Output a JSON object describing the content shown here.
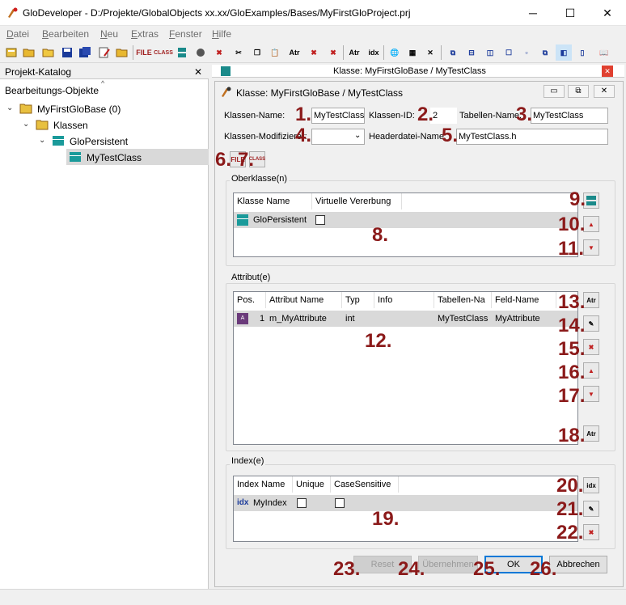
{
  "window": {
    "title": "GloDeveloper - D:/Projekte/GlobalObjects xx.xx/GloExamples/Bases/MyFirstGloProject.prj",
    "minimize": "─",
    "maximize": "☐",
    "close": "✕"
  },
  "menu": [
    {
      "key": "D",
      "rest": "atei"
    },
    {
      "key": "B",
      "rest": "earbeiten"
    },
    {
      "key": "N",
      "rest": "eu"
    },
    {
      "key": "E",
      "rest": "xtras"
    },
    {
      "key": "F",
      "rest": "enster"
    },
    {
      "key": "H",
      "rest": "ilfe"
    }
  ],
  "toolbar": {
    "file_label": "FILE",
    "class_label": "CLASS",
    "attr_label": "Atr",
    "idx_label": "idx"
  },
  "catalog": {
    "title": "Projekt-Katalog",
    "close": "✕",
    "root_label": "Bearbeitungs-Objekte",
    "base": "MyFirstGloBase (0)",
    "classes": "Klassen",
    "persistent": "GloPersistent",
    "selected": "MyTestClass"
  },
  "doc_tab": {
    "title": "Klasse: MyFirstGloBase / MyTestClass",
    "close": "✕"
  },
  "dialog": {
    "title": "Klasse: MyFirstGloBase / MyTestClass",
    "btn_min": "▭",
    "btn_restore": "⧉",
    "btn_close": "✕",
    "class_name_label": "Klassen-Name:",
    "class_name_value": "MyTestClass",
    "class_id_label": "Klassen-ID:",
    "class_id_value": "2",
    "table_name_label": "Tabellen-Name:",
    "table_name_value": "MyTestClass",
    "modifier_label": "Klassen-Modifizierer:",
    "modifier_value": "",
    "header_label": "Headerdatei-Name:",
    "header_value": "MyTestClass.h",
    "superclass_group": "Oberklasse(n)",
    "superclass_cols": [
      "Klasse Name",
      "Virtuelle Vererbung"
    ],
    "superclass_row": {
      "name": "GloPersistent",
      "virtual": false
    },
    "attr_group": "Attribut(e)",
    "attr_cols": [
      "Pos.",
      "Attribut Name",
      "Typ",
      "Info",
      "Tabellen-Na",
      "Feld-Name"
    ],
    "attr_row": {
      "pos": "1",
      "name": "m_MyAttribute",
      "type": "int",
      "info": "",
      "table": "MyTestClass",
      "field": "MyAttribute"
    },
    "index_group": "Index(e)",
    "index_cols": [
      "Index Name",
      "Unique",
      "CaseSensitive"
    ],
    "index_row": {
      "name": "MyIndex",
      "unique": false,
      "case_sensitive": false
    },
    "btn_reset": "Reset",
    "btn_apply": "Übernehmen",
    "btn_ok": "OK",
    "btn_cancel": "Abbrechen"
  },
  "callouts": [
    "1.",
    "2.",
    "3.",
    "4.",
    "5.",
    "6.",
    "7.",
    "8.",
    "9.",
    "10.",
    "11.",
    "12.",
    "13.",
    "14.",
    "15.",
    "16.",
    "17.",
    "18.",
    "19.",
    "20.",
    "21.",
    "22.",
    "23.",
    "24.",
    "25.",
    "26."
  ],
  "colors": {
    "callout": "#8b1a1a",
    "selection": "#d9d9d9",
    "accent": "#0078d7"
  }
}
